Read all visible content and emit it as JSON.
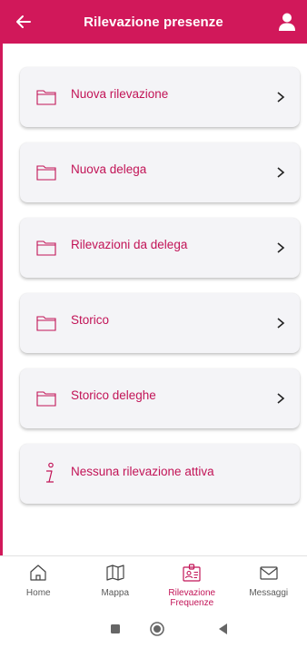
{
  "header": {
    "title": "Rilevazione presenze",
    "color": "#d1185a"
  },
  "menu": {
    "items": [
      {
        "label": "Nuova rilevazione",
        "icon": "folder-icon"
      },
      {
        "label": "Nuova delega",
        "icon": "folder-icon"
      },
      {
        "label": "Rilevazioni da delega",
        "icon": "folder-icon"
      },
      {
        "label": "Storico",
        "icon": "folder-icon"
      },
      {
        "label": "Storico deleghe",
        "icon": "folder-icon"
      }
    ],
    "info": {
      "label": "Nessuna rilevazione attiva",
      "icon": "info-icon"
    }
  },
  "bottom_nav": {
    "items": [
      {
        "label": "Home",
        "icon": "home-icon"
      },
      {
        "label": "Mappa",
        "icon": "map-icon"
      },
      {
        "label": "Rilevazione Frequenze",
        "icon": "badge-icon",
        "active": true
      },
      {
        "label": "Messaggi",
        "icon": "mail-icon"
      }
    ]
  },
  "colors": {
    "accent": "#d1185a",
    "card_bg": "#f4f4f7",
    "text_accent": "#c21457"
  }
}
